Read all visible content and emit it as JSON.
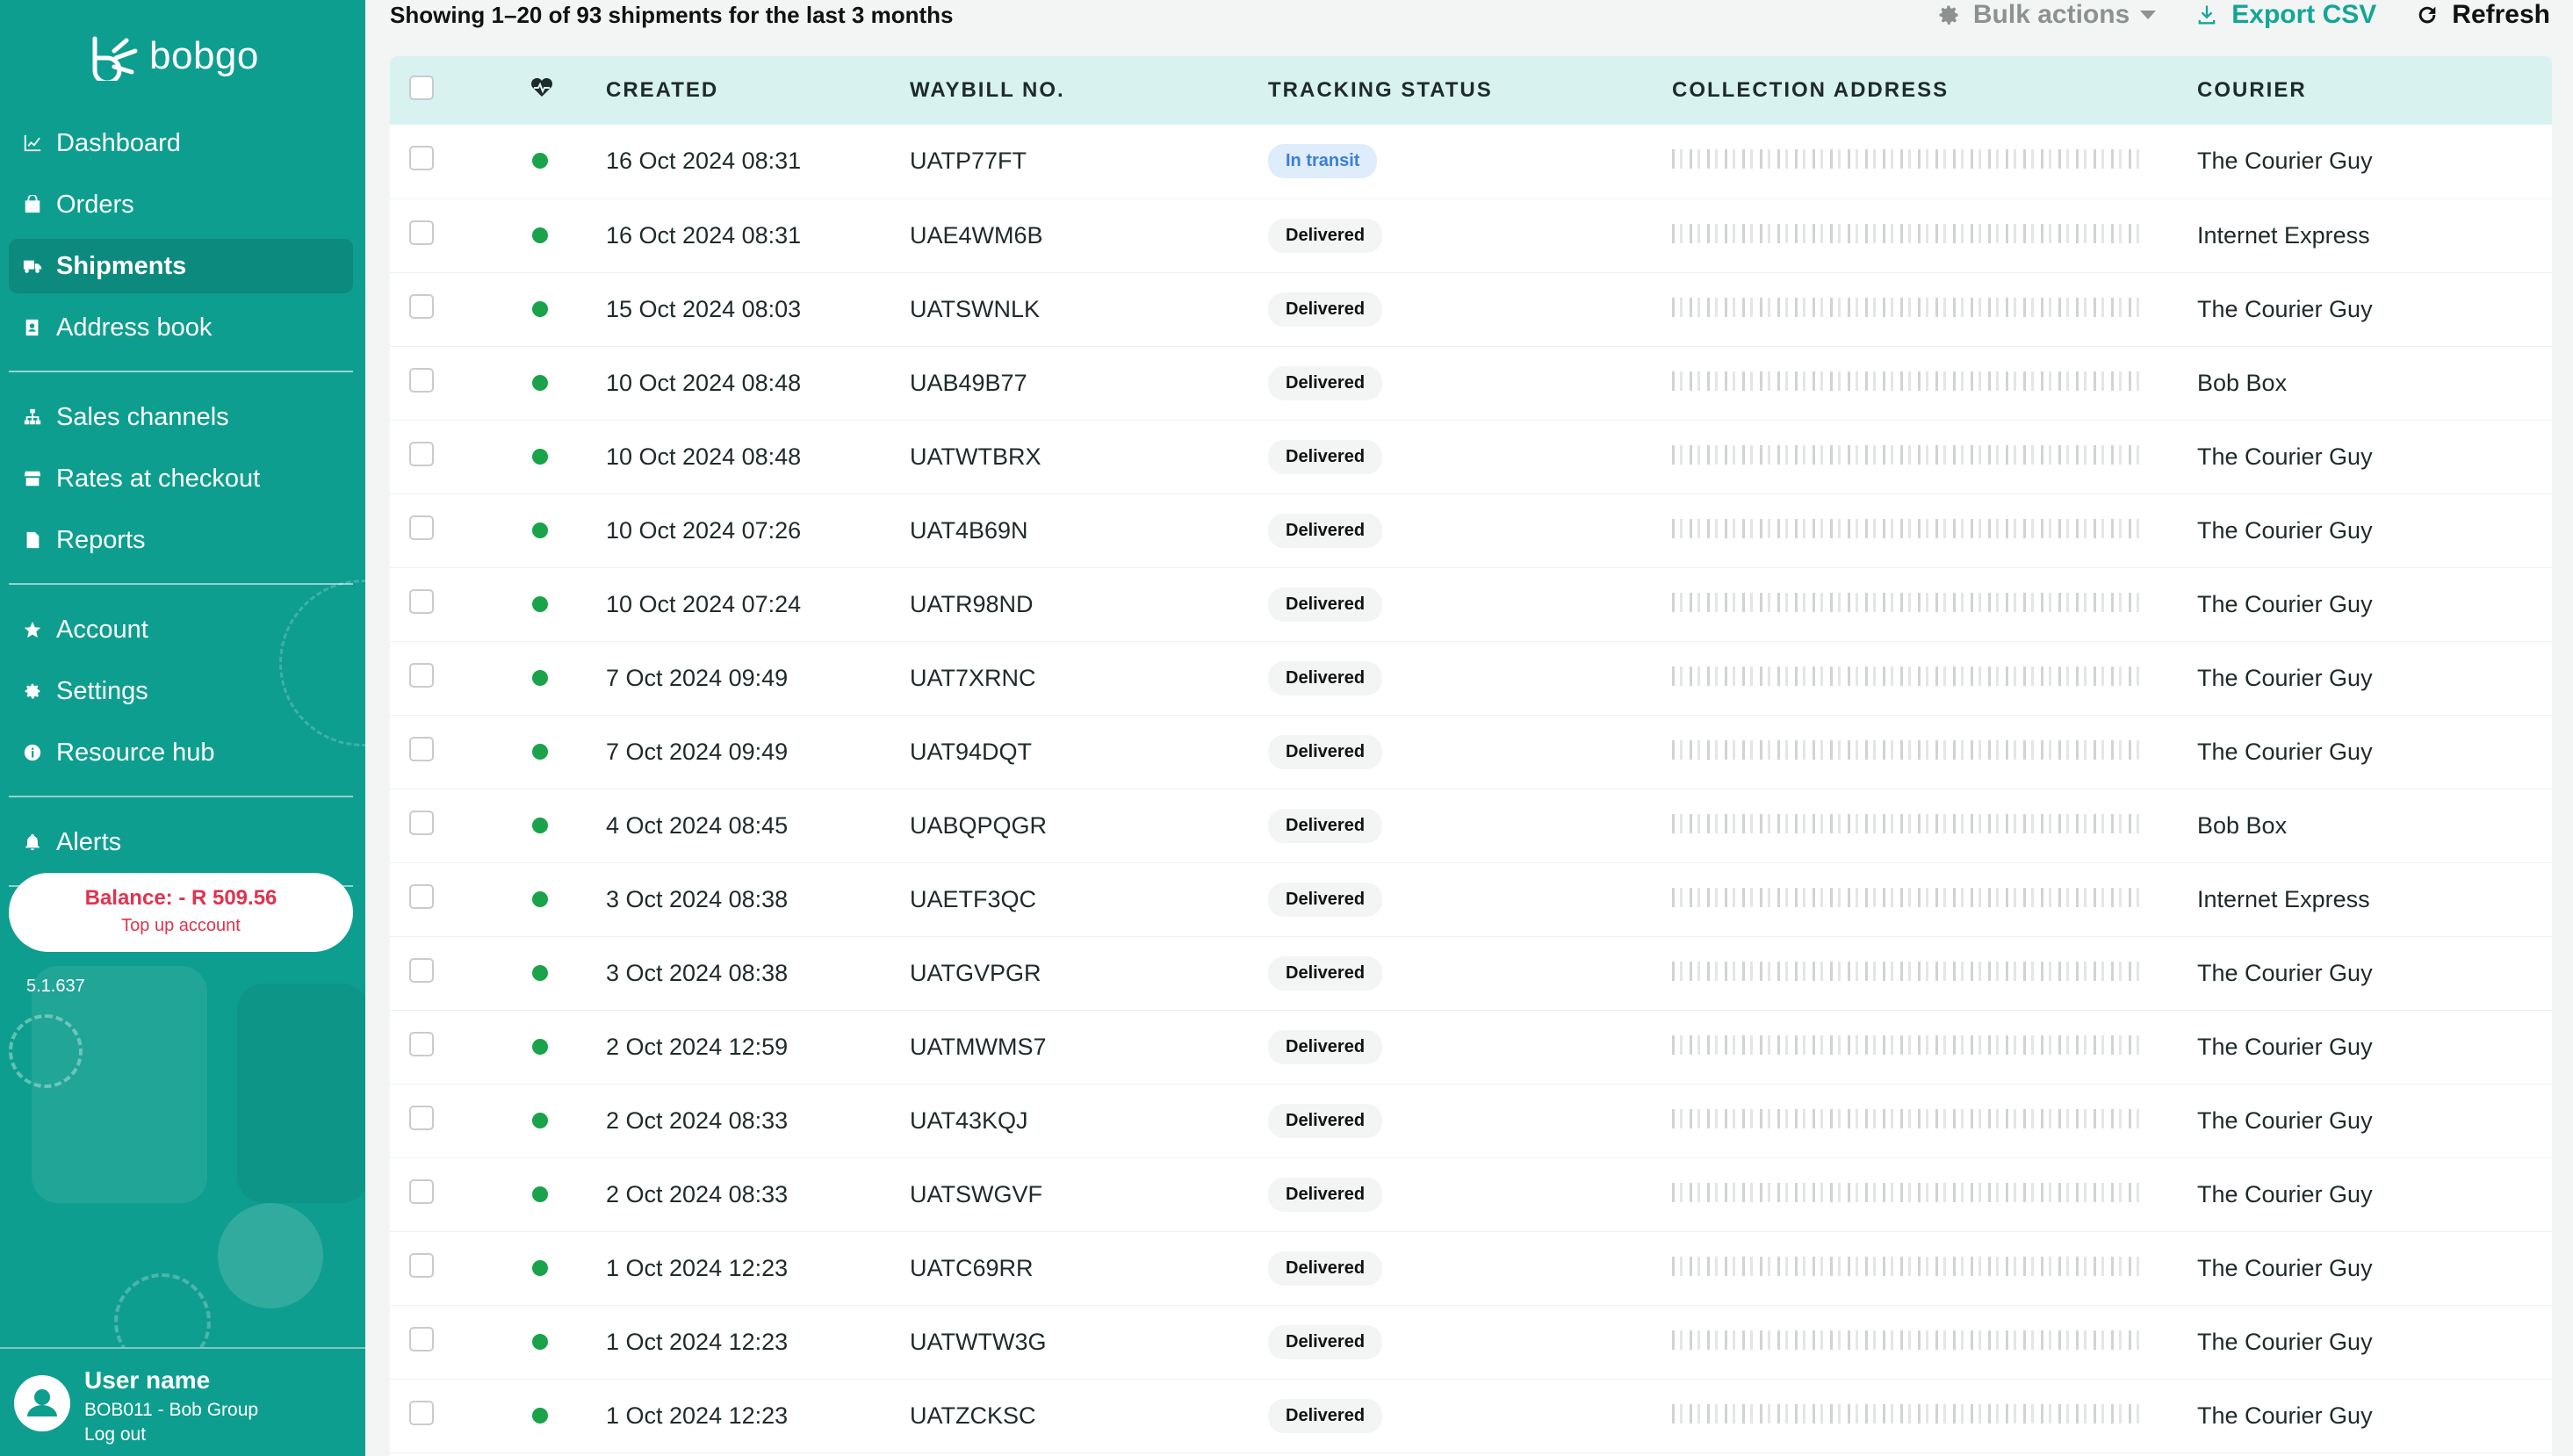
{
  "app": {
    "logo_text": "bobgo"
  },
  "sidebar": {
    "groups": [
      [
        {
          "label": "Dashboard",
          "icon": "chart-line-icon",
          "active": false
        },
        {
          "label": "Orders",
          "icon": "bag-icon",
          "active": false
        },
        {
          "label": "Shipments",
          "icon": "truck-icon",
          "active": true
        },
        {
          "label": "Address book",
          "icon": "address-book-icon",
          "active": false
        }
      ],
      [
        {
          "label": "Sales channels",
          "icon": "sitemap-icon",
          "active": false
        },
        {
          "label": "Rates at checkout",
          "icon": "store-icon",
          "active": false
        },
        {
          "label": "Reports",
          "icon": "document-icon",
          "active": false
        }
      ],
      [
        {
          "label": "Account",
          "icon": "star-icon",
          "active": false
        },
        {
          "label": "Settings",
          "icon": "gear-icon",
          "active": false
        },
        {
          "label": "Resource hub",
          "icon": "info-icon",
          "active": false
        }
      ],
      [
        {
          "label": "Alerts",
          "icon": "bell-icon",
          "active": false
        }
      ]
    ],
    "balance": "Balance: - R 509.56",
    "top_up": "Top up account",
    "version": "5.1.637",
    "user": {
      "name": "User name",
      "org": "BOB011 - Bob Group",
      "logout": "Log out"
    }
  },
  "toolbar": {
    "showing": "Showing 1–20 of 93 shipments for the last 3 months",
    "bulk_actions": "Bulk actions",
    "export_csv": "Export CSV",
    "refresh": "Refresh"
  },
  "table": {
    "headers": [
      "CREATED",
      "WAYBILL NO.",
      "TRACKING STATUS",
      "COLLECTION ADDRESS",
      "COURIER"
    ],
    "rows": [
      {
        "created": "16 Oct 2024 08:31",
        "waybill": "UATP77FT",
        "status": "In transit",
        "courier": "The Courier Guy"
      },
      {
        "created": "16 Oct 2024 08:31",
        "waybill": "UAE4WM6B",
        "status": "Delivered",
        "courier": "Internet Express"
      },
      {
        "created": "15 Oct 2024 08:03",
        "waybill": "UATSWNLK",
        "status": "Delivered",
        "courier": "The Courier Guy"
      },
      {
        "created": "10 Oct 2024 08:48",
        "waybill": "UAB49B77",
        "status": "Delivered",
        "courier": "Bob Box"
      },
      {
        "created": "10 Oct 2024 08:48",
        "waybill": "UATWTBRX",
        "status": "Delivered",
        "courier": "The Courier Guy"
      },
      {
        "created": "10 Oct 2024 07:26",
        "waybill": "UAT4B69N",
        "status": "Delivered",
        "courier": "The Courier Guy"
      },
      {
        "created": "10 Oct 2024 07:24",
        "waybill": "UATR98ND",
        "status": "Delivered",
        "courier": "The Courier Guy"
      },
      {
        "created": "7 Oct 2024 09:49",
        "waybill": "UAT7XRNC",
        "status": "Delivered",
        "courier": "The Courier Guy"
      },
      {
        "created": "7 Oct 2024 09:49",
        "waybill": "UAT94DQT",
        "status": "Delivered",
        "courier": "The Courier Guy"
      },
      {
        "created": "4 Oct 2024 08:45",
        "waybill": "UABQPQGR",
        "status": "Delivered",
        "courier": "Bob Box"
      },
      {
        "created": "3 Oct 2024 08:38",
        "waybill": "UAETF3QC",
        "status": "Delivered",
        "courier": "Internet Express"
      },
      {
        "created": "3 Oct 2024 08:38",
        "waybill": "UATGVPGR",
        "status": "Delivered",
        "courier": "The Courier Guy"
      },
      {
        "created": "2 Oct 2024 12:59",
        "waybill": "UATMWMS7",
        "status": "Delivered",
        "courier": "The Courier Guy"
      },
      {
        "created": "2 Oct 2024 08:33",
        "waybill": "UAT43KQJ",
        "status": "Delivered",
        "courier": "The Courier Guy"
      },
      {
        "created": "2 Oct 2024 08:33",
        "waybill": "UATSWGVF",
        "status": "Delivered",
        "courier": "The Courier Guy"
      },
      {
        "created": "1 Oct 2024 12:23",
        "waybill": "UATC69RR",
        "status": "Delivered",
        "courier": "The Courier Guy"
      },
      {
        "created": "1 Oct 2024 12:23",
        "waybill": "UATWTW3G",
        "status": "Delivered",
        "courier": "The Courier Guy"
      },
      {
        "created": "1 Oct 2024 12:23",
        "waybill": "UATZCKSC",
        "status": "Delivered",
        "courier": "The Courier Guy"
      }
    ]
  },
  "colors": {
    "brand": "#0e9e8f",
    "accent": "#13a696",
    "status_dot": "#1aa34a",
    "alert": "#e0334f"
  }
}
